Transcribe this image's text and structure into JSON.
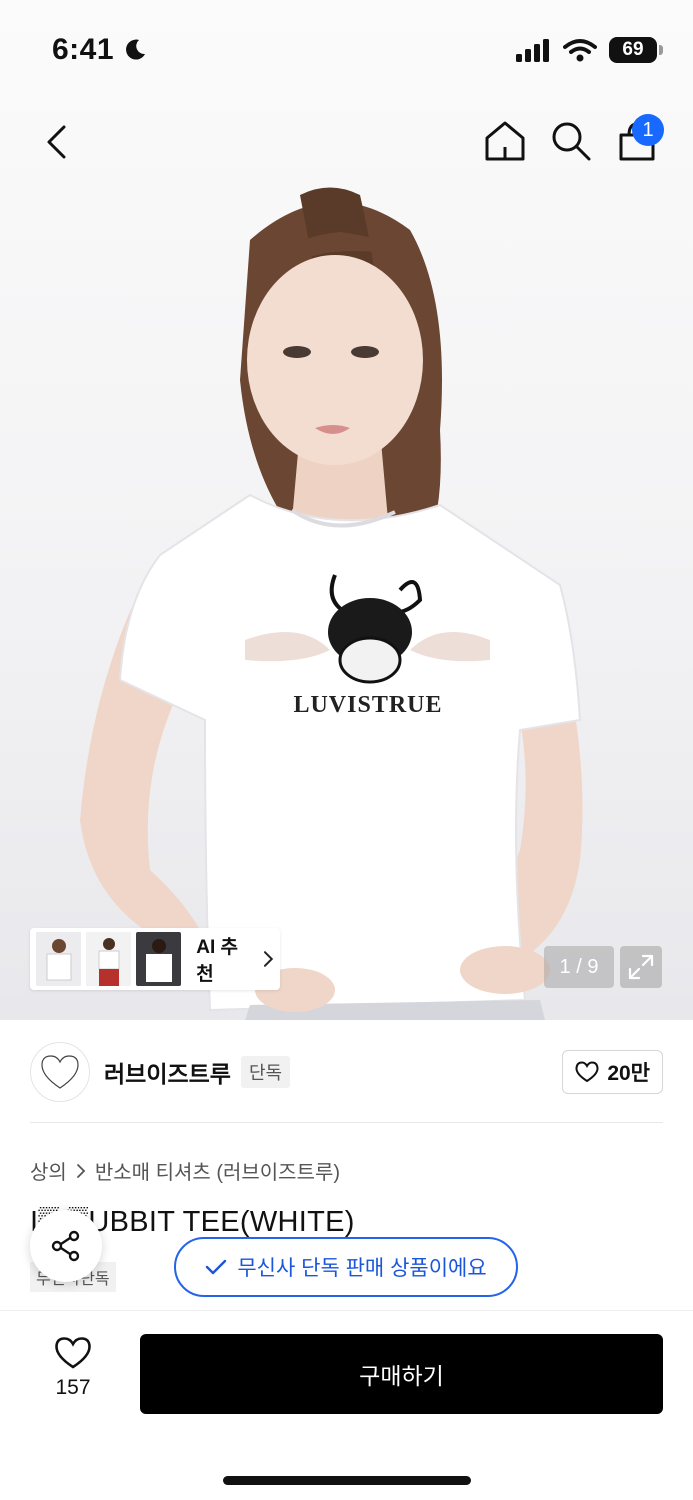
{
  "status_bar": {
    "time": "6:41",
    "battery": "69"
  },
  "nav": {
    "cart_count": "1"
  },
  "hero": {
    "print_text": "LUVISTRUE",
    "ai_recommend_label": "AI 추천",
    "page_counter": "1 / 9"
  },
  "brand": {
    "logo_text": "LUVISTRUE",
    "name": "러브이즈트루",
    "badge": "단독",
    "like_count": "20만"
  },
  "product": {
    "breadcrumb": [
      "상의",
      "반소매 티셔츠 (러브이즈트루)"
    ],
    "title": "I▒ ▒UBBIT TEE(WHITE)",
    "tag": "무신사단독",
    "exclusive_toast": "무신사 단독 판매 상품이에요"
  },
  "bottom": {
    "wish_count": "157",
    "buy_label": "구매하기"
  },
  "colors": {
    "accent_blue": "#1769ff",
    "toast_blue": "#2463eb",
    "buy_button": "#000000"
  }
}
